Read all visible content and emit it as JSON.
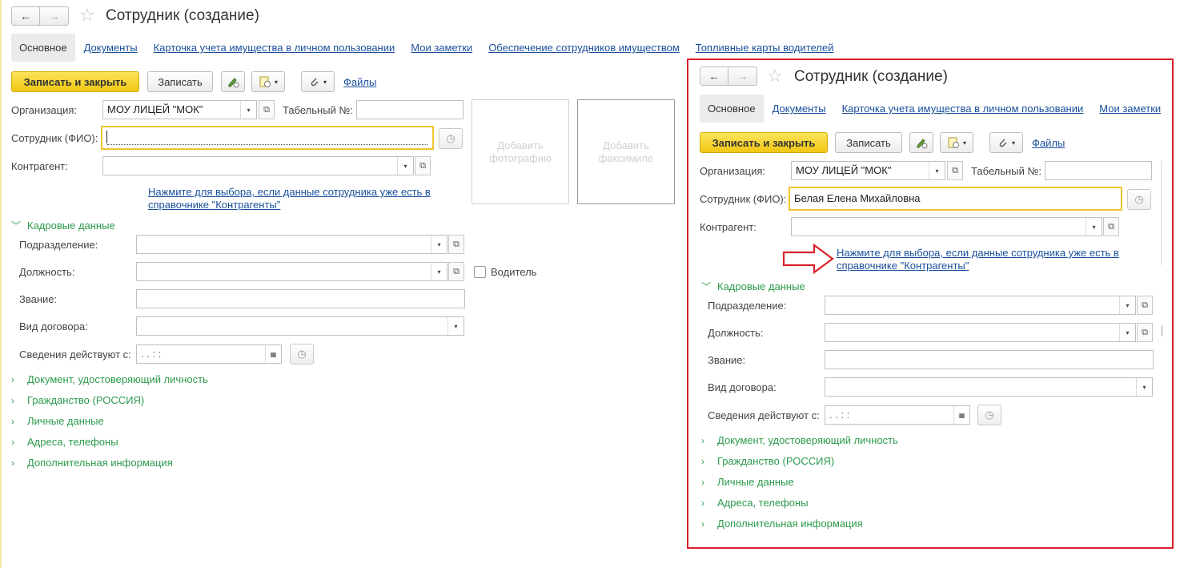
{
  "main": {
    "title": "Сотрудник (создание)",
    "tabs": [
      "Основное",
      "Документы",
      "Карточка учета имущества в личном пользовании",
      "Мои заметки",
      "Обеспечение сотрудников имуществом",
      "Топливные карты водителей"
    ],
    "toolbar": {
      "save_close": "Записать и закрыть",
      "save": "Записать",
      "files": "Файлы"
    },
    "org_label": "Организация:",
    "org_value": "МОУ ЛИЦЕЙ \"МОК\"",
    "tab_num_label": "Табельный №:",
    "employee_label": "Сотрудник (ФИО):",
    "employee_value": "",
    "contractor_label": "Контрагент:",
    "hint_line1": "Нажмите для выбора, если данные сотрудника уже есть в",
    "hint_line2": "справочнике \"Контрагенты\"",
    "photo_label": "Добавить фотографию",
    "facsimile_label": "Добавить факсимиле",
    "hr_section": "Кадровые данные",
    "dept_label": "Подразделение:",
    "position_label": "Должность:",
    "driver_label": "Водитель",
    "rank_label": "Звание:",
    "contract_label": "Вид договора:",
    "valid_label": "Сведения действуют с:",
    "date_placeholder": " .  .      :  :",
    "sections": [
      "Документ, удостоверяющий личность",
      "Гражданство (РОССИЯ)",
      "Личные данные",
      "Адреса, телефоны",
      "Дополнительная информация"
    ]
  },
  "inset": {
    "title": "Сотрудник (создание)",
    "tabs": [
      "Основное",
      "Документы",
      "Карточка учета имущества в личном пользовании",
      "Мои заметки"
    ],
    "toolbar": {
      "save_close": "Записать и закрыть",
      "save": "Записать",
      "files": "Файлы"
    },
    "org_label": "Организация:",
    "org_value": "МОУ ЛИЦЕЙ \"МОК\"",
    "tab_num_label": "Табельный №:",
    "employee_label": "Сотрудник (ФИО):",
    "employee_value": "Белая Елена Михайловна",
    "contractor_label": "Контрагент:",
    "hint_line1": "Нажмите для выбора, если данные сотрудника уже есть в",
    "hint_line2": "справочнике \"Контрагенты\"",
    "hr_section": "Кадровые данные",
    "dept_label": "Подразделение:",
    "position_label": "Должность:",
    "rank_label": "Звание:",
    "contract_label": "Вид договора:",
    "valid_label": "Сведения действуют с:",
    "date_placeholder": " .  .      :  :",
    "sections": [
      "Документ, удостоверяющий личность",
      "Гражданство (РОССИЯ)",
      "Личные данные",
      "Адреса, телефоны",
      "Дополнительная информация"
    ]
  },
  "icons": {
    "back": "←",
    "forward": "→",
    "star": "☆",
    "dropdown": "▾",
    "open": "⧉",
    "history": "◷",
    "calendar": "▦",
    "chevron_down": "﹀",
    "chevron_right": "›"
  },
  "colors": {
    "accent_green": "#2b9a4b",
    "link_blue": "#1a4f9c",
    "primary_yellow": "#f5d02a",
    "highlight_red": "#d9222d"
  }
}
